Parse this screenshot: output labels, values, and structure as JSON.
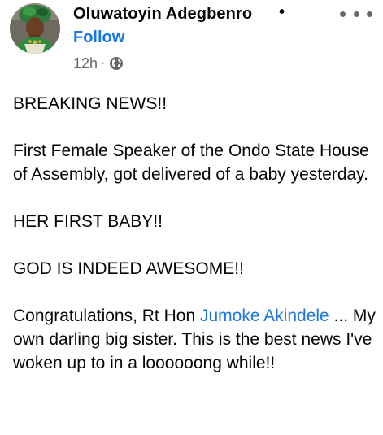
{
  "post": {
    "author": {
      "name": "Oluwatoyin Adegbenro",
      "separator": "•",
      "follow_label": "Follow"
    },
    "meta": {
      "time": "12h",
      "separator": "·",
      "audience_icon": "globe-icon"
    },
    "more_icon": "ellipsis-horizontal-icon",
    "body": {
      "p1": "BREAKING NEWS!!",
      "p2": "First Female Speaker of the Ondo State House of Assembly, got delivered of a baby yesterday.",
      "p3": "HER FIRST BABY!!",
      "p4": "GOD IS INDEED AWESOME!!",
      "p5_before": "Congratulations, Rt Hon ",
      "p5_tag": "Jumoke Akindele",
      "p5_after": " ... My own darling big sister. This is the best news I've woken up to in a loooooong while!!"
    },
    "colors": {
      "link": "#1b74e4",
      "text": "#050505",
      "secondary": "#65676b"
    }
  }
}
